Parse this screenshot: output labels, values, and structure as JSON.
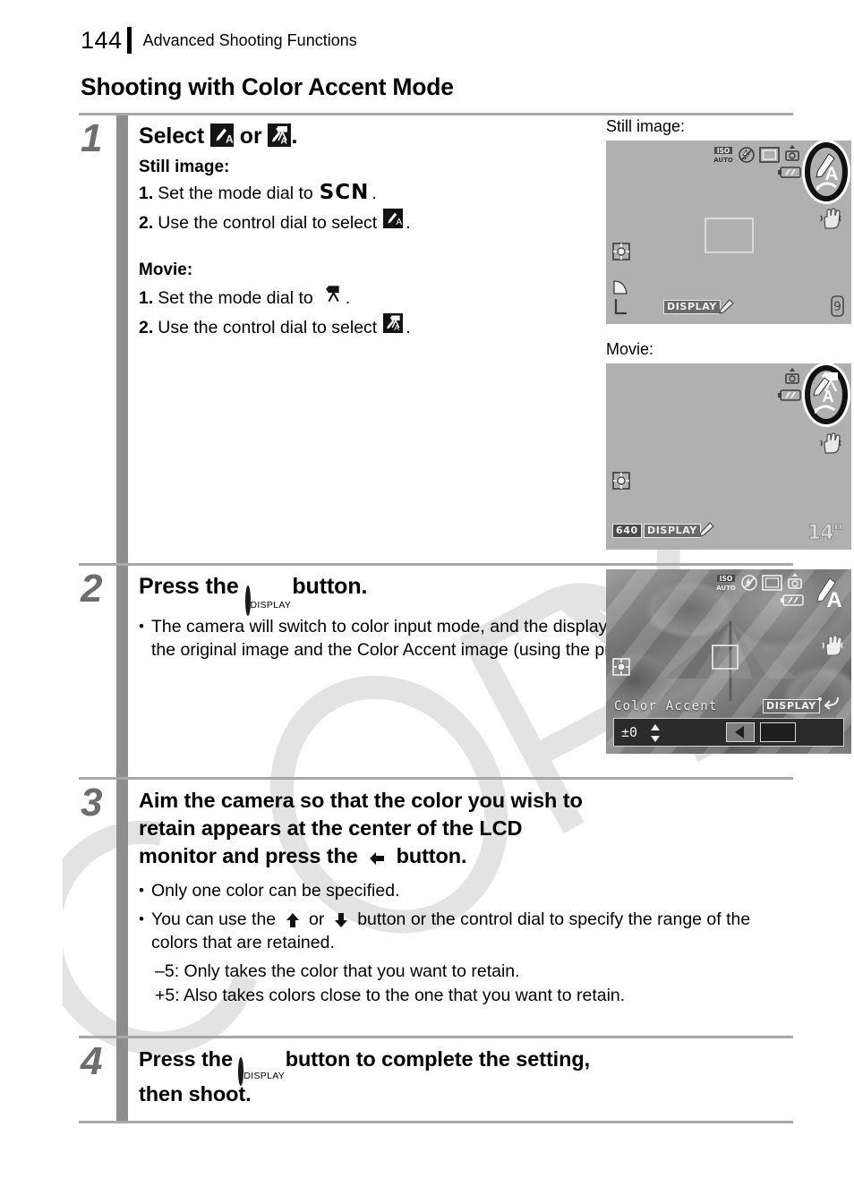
{
  "header": {
    "page_number": "144",
    "running_title": "Advanced Shooting Functions"
  },
  "section_title": "Shooting with Color Accent Mode",
  "steps": [
    {
      "number": "1",
      "head_before": "Select",
      "head_middle": "or",
      "head_after": ".",
      "icon_still": "color-accent-still-icon",
      "icon_movie": "color-accent-movie-icon",
      "still_label": "Still image:",
      "still_1_num": "1.",
      "still_1_text": "Set the mode dial to",
      "still_1_glyph": "SCN",
      "still_1_end": ".",
      "still_2_num": "2.",
      "still_2_text": "Use the control dial to select",
      "still_2_end": ".",
      "movie_label": "Movie:",
      "movie_1_num": "1.",
      "movie_1_text": "Set the mode dial to",
      "movie_1_end": ".",
      "movie_2_num": "2.",
      "movie_2_text": "Use the control dial to select",
      "movie_2_end": "."
    },
    {
      "number": "2",
      "head_before": "Press the",
      "head_after": "button.",
      "button_label": "DISPLAY",
      "bullet": "The camera will switch to color input mode, and the display will alternate between the original image and the Color Accent image (using the previously set color)."
    },
    {
      "number": "3",
      "head_line1": "Aim the camera so that the color you wish to",
      "head_line2": "retain appears at the center of the LCD",
      "head_line3_a": "monitor and press the",
      "head_line3_b": "button.",
      "bullet1": "Only one color can be specified.",
      "bullet2_a": "You can use the",
      "bullet2_or": "or",
      "bullet2_b": "button or the control dial to specify the range of the colors that are retained.",
      "note_minus": "–5: Only takes the color that you want to retain.",
      "note_plus": "+5: Also takes colors close to the one that you want to retain."
    },
    {
      "number": "4",
      "head_before": "Press the",
      "head_mid": "button to complete the setting,",
      "head_line2": "then shoot.",
      "button_label": "DISPLAY"
    }
  ],
  "lcd_still": {
    "caption": "Still image:",
    "iso_label": "ISO",
    "iso_sub": "AUTO",
    "display_chip": "DISPLAY",
    "quality_glyph": "L",
    "frames_remaining": "9",
    "icons": [
      "iso-auto-icon",
      "flash-off-icon",
      "frame-icon",
      "camera-shake-icon",
      "battery-icon",
      "color-accent-mode-icon",
      "image-stabilizer-icon",
      "metering-icon",
      "compression-icon",
      "display-chip-icon",
      "eyedropper-icon"
    ]
  },
  "lcd_movie": {
    "caption": "Movie:",
    "resolution_chip": "640",
    "display_chip": "DISPLAY",
    "recording_time": "14\"",
    "icons": [
      "camera-shake-icon",
      "battery-icon",
      "color-accent-movie-mode-icon",
      "image-stabilizer-icon",
      "metering-icon",
      "resolution-chip-icon",
      "display-chip-icon",
      "eyedropper-icon"
    ]
  },
  "lcd_accent": {
    "title": "Color Accent",
    "display_chip": "DISPLAY",
    "value": "±0",
    "icons": [
      "iso-auto-icon",
      "flash-off-icon",
      "frame-icon",
      "camera-shake-icon",
      "battery-icon",
      "color-accent-mode-icon",
      "image-stabilizer-icon",
      "metering-icon",
      "focus-frame-icon",
      "return-arrow-icon",
      "up-down-arrow-icon",
      "left-arrow-icon"
    ]
  },
  "watermark": {
    "text": "COPY"
  },
  "colors": {
    "gutter": "#8d8d8d",
    "step_number": "#6d6d6d",
    "rule": "#a8a8a8",
    "lcd_bg": "#b0b0b0",
    "watermark": "#e2e2e2"
  }
}
